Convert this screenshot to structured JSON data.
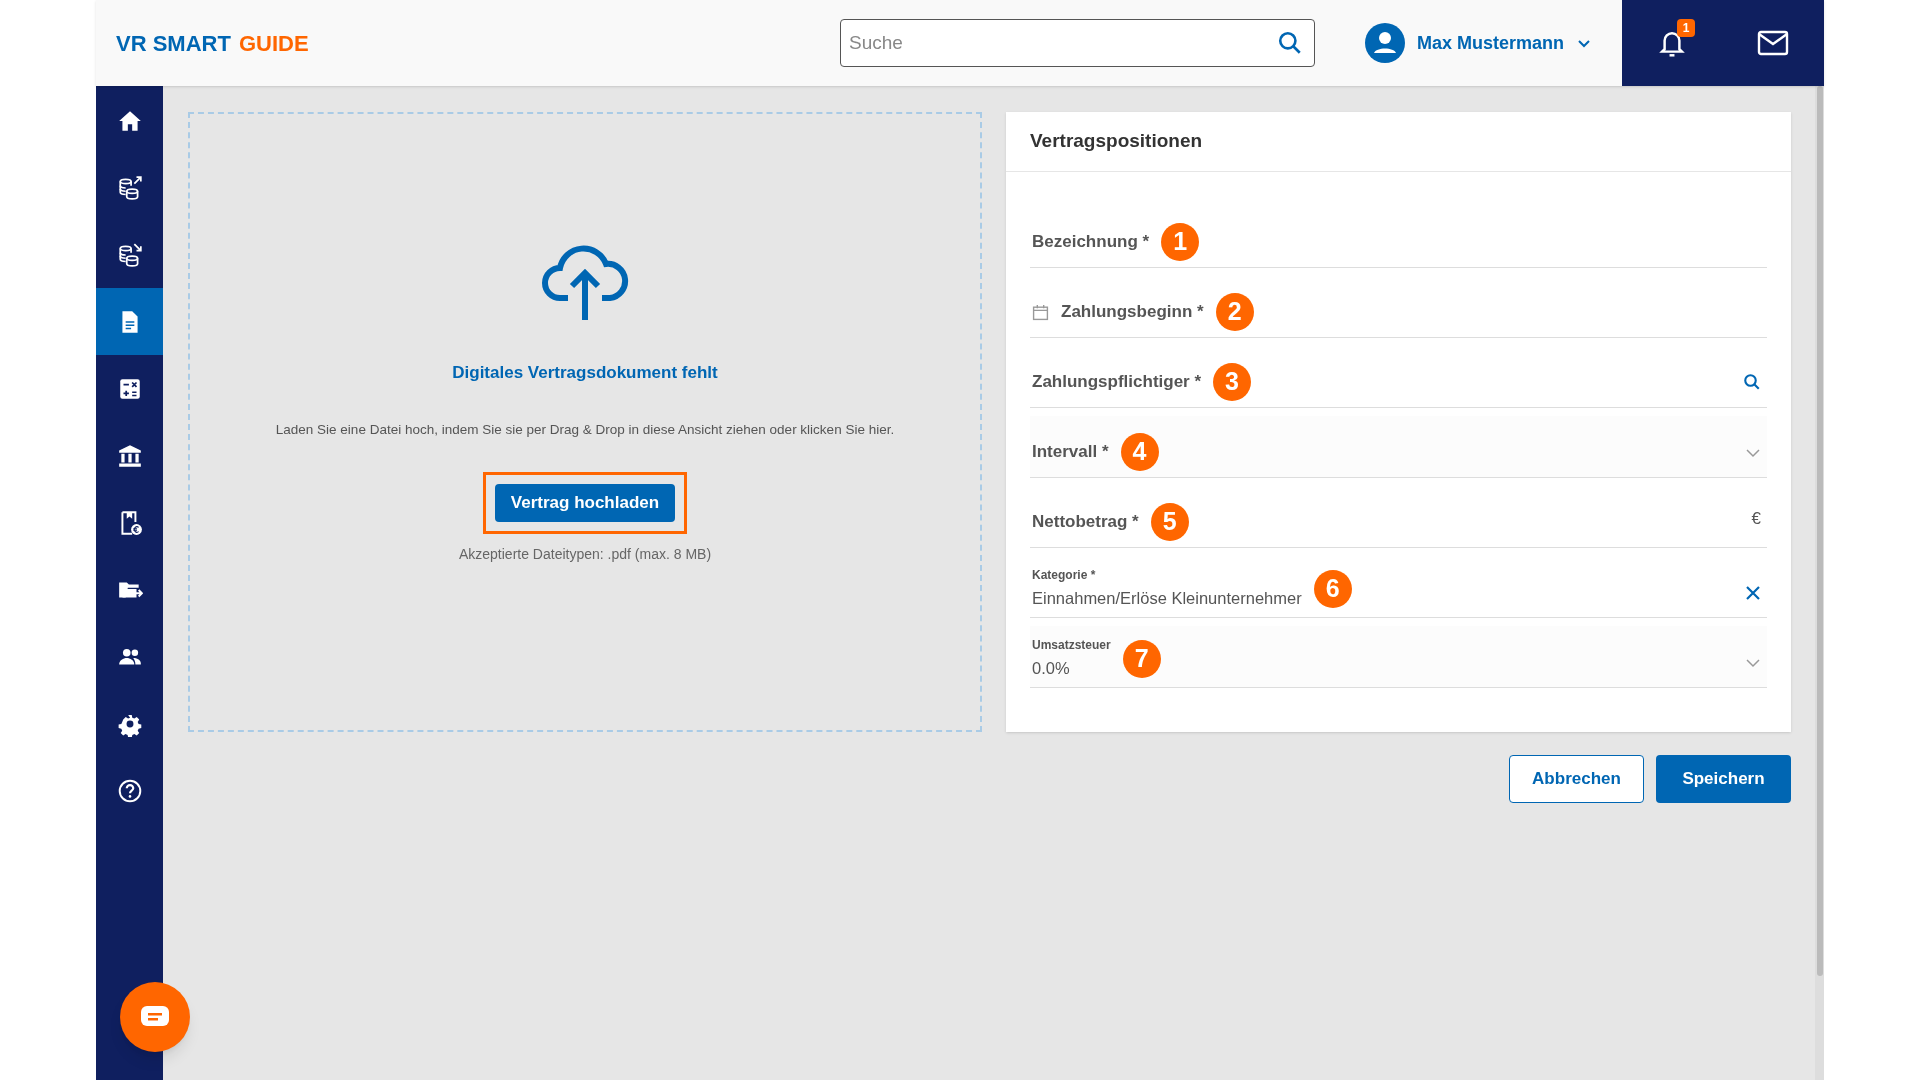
{
  "header": {
    "logo_primary": "VR SMART",
    "logo_accent": "GUIDE",
    "search": {
      "placeholder": "Suche"
    },
    "user": {
      "name": "Max Mustermann"
    },
    "notifications": {
      "count": "1"
    }
  },
  "sidebar": {
    "items": [
      {
        "kind": "home",
        "selected": false
      },
      {
        "kind": "coins-up",
        "selected": false
      },
      {
        "kind": "coins-down",
        "selected": false
      },
      {
        "kind": "document",
        "selected": true
      },
      {
        "kind": "calculator",
        "selected": false
      },
      {
        "kind": "bank",
        "selected": false
      },
      {
        "kind": "document-euro",
        "selected": false
      },
      {
        "kind": "folder-arrow",
        "selected": false
      },
      {
        "kind": "users",
        "selected": false
      },
      {
        "kind": "gear",
        "selected": false
      },
      {
        "kind": "help",
        "selected": false
      }
    ]
  },
  "upload": {
    "title": "Digitales Vertragsdokument fehlt",
    "description": "Laden Sie eine Datei hoch, indem Sie sie per Drag & Drop in diese Ansicht ziehen oder klicken Sie hier.",
    "button": "Vertrag hochladen",
    "hint": "Akzeptierte Dateitypen: .pdf (max. 8 MB)"
  },
  "form": {
    "title": "Vertragspositionen",
    "fields": [
      {
        "kind": "text",
        "label": "Bezeichnung *",
        "marker": "1"
      },
      {
        "kind": "date",
        "label": "Zahlungsbeginn *",
        "marker": "2"
      },
      {
        "kind": "search",
        "label": "Zahlungspflichtiger *",
        "marker": "3"
      },
      {
        "kind": "select",
        "label": "Intervall *",
        "marker": "4"
      },
      {
        "kind": "amount",
        "label": "Nettobetrag *",
        "suffix": "€",
        "marker": "5"
      },
      {
        "kind": "clearable",
        "label": "Kategorie *",
        "value": "Einnahmen/Erlöse Kleinunternehmer",
        "marker": "6"
      },
      {
        "kind": "select",
        "label": "Umsatzsteuer",
        "value": "0.0%",
        "marker": "7"
      }
    ]
  },
  "buttons": [
    {
      "kind": "secondary",
      "label": "Abbrechen"
    },
    {
      "kind": "primary",
      "label": "Speichern"
    }
  ]
}
